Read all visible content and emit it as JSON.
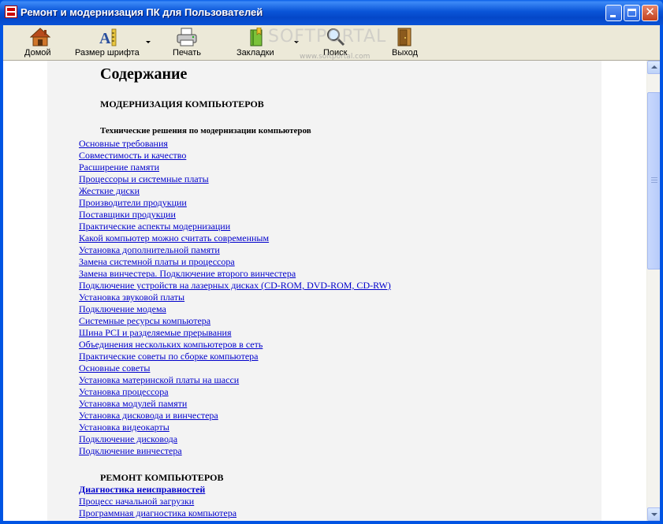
{
  "window": {
    "title": "Ремонт и модернизация ПК для Пользователей",
    "close_glyph": "✕"
  },
  "toolbar": {
    "home_label": "Домой",
    "font_size_label": "Размер шрифта",
    "print_label": "Печать",
    "bookmarks_label": "Закладки",
    "search_label": "Поиск",
    "exit_label": "Выход"
  },
  "watermark": {
    "text": "SOFTPORTAL",
    "url": "www.softportal.com"
  },
  "page": {
    "heading": "Содержание",
    "section1_title": "МОДЕРНИЗАЦИЯ КОМПЬЮТЕРОВ",
    "subsection1_title": "Технические решения по модернизации компьютеров",
    "links1": [
      "Основные требования",
      "Совместимость и качество",
      "Расширение памяти",
      "Процессоры и системные платы",
      "Жесткие диски",
      "Производители продукции",
      "Поставщики продукции",
      "Практические аспекты модернизации",
      "Какой компьютер можно считать современным",
      "Установка дополнительной памяти",
      "Замена системной платы и процессора",
      "Замена винчестера. Подключение второго винчестера",
      "Подключение устройств на лазерных дисках (CD-ROM, DVD-ROM, CD-RW)",
      "Установка звуковой платы",
      "Подключение модема",
      "Системные ресурсы компьютера",
      "Шина PCI и разделяемые прерывания",
      "Объединения нескольких компьютеров в сеть",
      "Практические советы по сборке компьютера",
      "Основные советы",
      "Установка материнской платы на шасси",
      "Установка процессора",
      "Установка модулей памяти",
      "Установка дисковода и винчестера",
      "Установка видеокарты",
      "Подключение дисковода",
      "Подключение винчестера"
    ],
    "section2_title": "РЕМОНТ КОМПЬЮТЕРОВ",
    "links2": [
      "Диагностика неисправностей",
      "Процесс начальной загрузки",
      "Программная диагностика компьютера"
    ]
  },
  "colors": {
    "title_bar": "#0a55d8",
    "link": "#0000cc",
    "content_bg": "#f3f3f3",
    "toolbar_bg": "#ece9d8"
  }
}
